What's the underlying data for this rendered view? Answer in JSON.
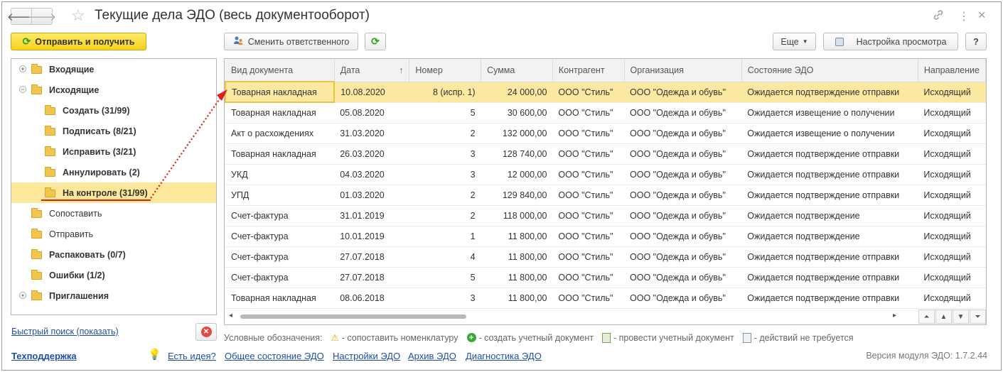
{
  "window": {
    "title": "Текущие дела ЭДО (весь документооборот)",
    "back": "🡐",
    "forward": "🡒",
    "link_icon": "link-icon",
    "more_icon": "⋮",
    "close_icon": "×"
  },
  "toolbar": {
    "send_receive": "Отправить и получить",
    "change_responsible": "Сменить ответственного",
    "more": "Еще",
    "view_settings": "Настройка просмотра",
    "help": "?"
  },
  "tree": {
    "items": [
      {
        "label": "Входящие",
        "bold": true,
        "expander": "+"
      },
      {
        "label": "Исходящие",
        "bold": true,
        "expander": "−"
      },
      {
        "label": "Создать (31/99)",
        "bold": true
      },
      {
        "label": "Подписать (8/21)",
        "bold": true
      },
      {
        "label": "Исправить (3/21)",
        "bold": true
      },
      {
        "label": "Аннулировать (2)",
        "bold": true
      },
      {
        "label": "На контроле (31/99)",
        "bold": true,
        "selected": true
      },
      {
        "label": "Сопоставить",
        "bold": false
      },
      {
        "label": "Отправить",
        "bold": false
      },
      {
        "label": "Распаковать (0/7)",
        "bold": true
      },
      {
        "label": "Ошибки (1/2)",
        "bold": true
      },
      {
        "label": "Приглашения",
        "bold": true,
        "expander": "+"
      }
    ]
  },
  "table": {
    "columns": [
      "Вид документа",
      "Дата",
      "Номер",
      "Сумма",
      "Контрагент",
      "Организация",
      "Состояние ЭДО",
      "Направление"
    ],
    "sort_arrow": "↑",
    "rows": [
      [
        "Товарная накладная",
        "10.08.2020",
        "8 (испр. 1)",
        "24 000,00",
        "ООО \"Стиль\"",
        "ООО \"Одежда и обувь\"",
        "Ожидается подтверждение отправки",
        "Исходящий"
      ],
      [
        "Товарная накладная",
        "05.08.2020",
        "5",
        "30 600,00",
        "ООО \"Стиль\"",
        "ООО \"Одежда и обувь\"",
        "Ожидается извещение о получении",
        "Исходящий"
      ],
      [
        "Акт о расхождениях",
        "31.03.2020",
        "2",
        "132 000,00",
        "ООО \"Стиль\"",
        "ООО \"Одежда и обувь\"",
        "Ожидается извещение о получении",
        "Исходящий"
      ],
      [
        "Товарная накладная",
        "26.03.2020",
        "3",
        "128 740,00",
        "ООО \"Стиль\"",
        "ООО \"Одежда и обувь\"",
        "Ожидается подтверждение отправки",
        "Исходящий"
      ],
      [
        "УКД",
        "04.03.2020",
        "3",
        "12 000,00",
        "ООО \"Стиль\"",
        "ООО \"Одежда и обувь\"",
        "Ожидается подтверждение отправки",
        "Исходящий"
      ],
      [
        "УПД",
        "01.03.2020",
        "2",
        "129 840,00",
        "ООО \"Стиль\"",
        "ООО \"Одежда и обувь\"",
        "Ожидается подтверждение отправки",
        "Исходящий"
      ],
      [
        "Счет-фактура",
        "31.01.2019",
        "2",
        "118 000,00",
        "ООО \"Стиль\"",
        "ООО \"Одежда и обувь\"",
        "Ожидается подтверждение",
        "Исходящий"
      ],
      [
        "Счет-фактура",
        "10.01.2019",
        "1",
        "11 800,00",
        "ООО \"Стиль\"",
        "ООО \"Одежда и обувь\"",
        "Ожидается подтверждение",
        "Исходящий"
      ],
      [
        "Счет-фактура",
        "27.07.2018",
        "4",
        "11 800,00",
        "ООО \"Стиль\"",
        "ООО \"Одежда и обувь\"",
        "Ожидается подтверждение отправки",
        "Исходящий"
      ],
      [
        "Счет-фактура",
        "27.07.2018",
        "5",
        "11 800,00",
        "ООО \"Стиль\"",
        "ООО \"Одежда и обувь\"",
        "Ожидается подтверждение отправки",
        "Исходящий"
      ],
      [
        "Товарная накладная",
        "08.06.2018",
        "3",
        "11 800,00",
        "ООО \"Стиль\"",
        "ООО \"Одежда и обувь\"",
        "Ожидается подтверждение отправки",
        "Исходящий"
      ]
    ]
  },
  "bottom": {
    "quick_search": "Быстрый поиск (показать)",
    "support": "Техподдержка",
    "idea": "Есть идея?",
    "links": [
      "Общее состояние ЭДО",
      "Настройки ЭДО",
      "Архив ЭДО",
      "Диагностика ЭДО"
    ],
    "legend_label": "Условные обозначения:",
    "legend": [
      {
        "icon": "warning-icon",
        "text": "- сопоставить номенклатуру"
      },
      {
        "icon": "plus-circle-icon",
        "text": "- создать учетный документ"
      },
      {
        "icon": "post-document-icon",
        "text": "- провести учетный документ"
      },
      {
        "icon": "no-action-icon",
        "text": "- действий не требуется"
      }
    ],
    "version": "Версия модуля ЭДО: 1.7.2.44"
  },
  "colors": {
    "accent_yellow": "#f5d318",
    "selection": "#fbe89a",
    "link": "#1f4fa3",
    "annotation_red": "#d9201a"
  }
}
